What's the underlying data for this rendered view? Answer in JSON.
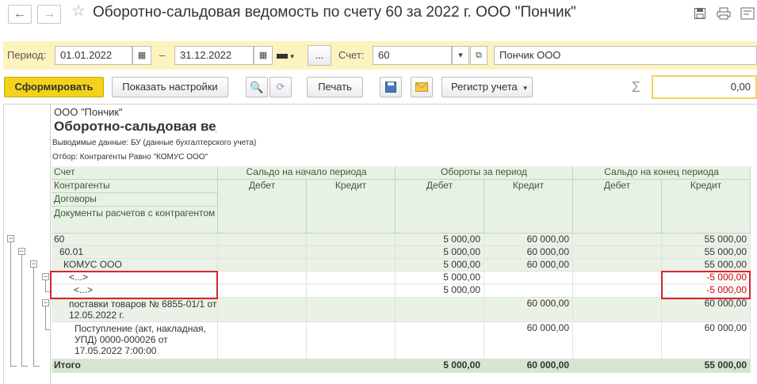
{
  "window": {
    "title": "Оборотно-сальдовая ведомость по счету 60 за 2022 г. ООО \"Пончик\""
  },
  "params": {
    "period_label": "Период:",
    "date_from": "01.01.2022",
    "dash": "–",
    "date_to": "31.12.2022",
    "more_label": "...",
    "account_label": "Счет:",
    "account_value": "60",
    "org_value": "Пончик ООО"
  },
  "toolbar": {
    "generate": "Сформировать",
    "settings": "Показать настройки",
    "print": "Печать",
    "register": "Регистр учета",
    "sum_symbol": "Σ",
    "sum_value": "0,00"
  },
  "report": {
    "org": "ООО \"Пончик\"",
    "title": "Оборотно-сальдовая ведо",
    "output": "Выводимые данные: БУ (данные бухгалтерского учета)",
    "filter": "Отбор: Контрагенты Равно \"КОМУС ООО\"",
    "col_account": "Счет",
    "col_counterparties": "Контрагенты",
    "col_contracts": "Договоры",
    "col_docs": "Документы расчетов с контрагентом",
    "grp_start": "Сальдо на начало периода",
    "grp_turnover": "Обороты за период",
    "grp_end": "Сальдо на конец периода",
    "debit": "Дебет",
    "credit": "Кредит",
    "rows": [
      {
        "name": "60",
        "v3": "5 000,00",
        "v4": "60 000,00",
        "v6": "55 000,00"
      },
      {
        "name": "60.01",
        "v3": "5 000,00",
        "v4": "60 000,00",
        "v6": "55 000,00"
      },
      {
        "name": "КОМУС ООО",
        "v3": "5 000,00",
        "v4": "60 000,00",
        "v6": "55 000,00"
      },
      {
        "name": "<...>",
        "v3": "5 000,00",
        "v4": "",
        "v6": "-5 000,00"
      },
      {
        "name": "<...>",
        "v3": "5 000,00",
        "v4": "",
        "v6": "-5 000,00"
      },
      {
        "name": "поставки товаров № 6855-01/1 от 12.05.2022 г.",
        "v3": "",
        "v4": "60 000,00",
        "v6": "60 000,00"
      },
      {
        "name": "Поступление (акт, накладная, УПД) 0000-000026 от 17.05.2022 7:00:00",
        "v3": "",
        "v4": "60 000,00",
        "v6": "60 000,00"
      }
    ],
    "total": {
      "name": "Итого",
      "v3": "5 000,00",
      "v4": "60 000,00",
      "v6": "55 000,00"
    }
  }
}
